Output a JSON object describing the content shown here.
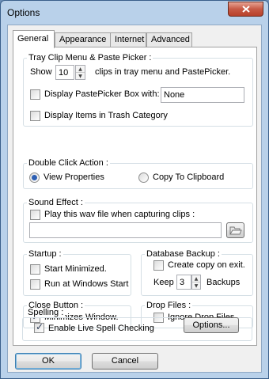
{
  "window": {
    "title": "Options"
  },
  "tabs": [
    "General",
    "Appearance",
    "Internet",
    "Advanced"
  ],
  "tray": {
    "title": "Tray Clip Menu & Paste Picker :",
    "show_label": "Show",
    "clips_count": "10",
    "clips_suffix": "clips in tray menu and PastePicker.",
    "display_box_label": "Display PastePicker Box  with:",
    "display_box_value": "None",
    "trash_label": "Display Items in Trash Category"
  },
  "double_click": {
    "title": "Double Click Action :",
    "option_view": "View Properties",
    "option_copy": "Copy To Clipboard"
  },
  "sound": {
    "title": "Sound Effect :",
    "play_label": "Play this wav file when capturing clips :",
    "path_value": ""
  },
  "startup": {
    "title": "Startup :",
    "minimized_label": "Start Minimized.",
    "windows_label": "Run at Windows Start"
  },
  "database": {
    "title": "Database Backup :",
    "copy_label": "Create copy on exit.",
    "keep_label": "Keep",
    "keep_value": "3",
    "backups_label": "Backups"
  },
  "close_button": {
    "title": "Close Button :",
    "minimizes_label": "Minimizes Window."
  },
  "drop_files": {
    "title": "Drop Files :",
    "ignore_label": "Ignore Drop Files."
  },
  "spelling": {
    "title": "Spelling :",
    "enable_label": "Enable Live Spell Checking",
    "options_button": "Options..."
  },
  "footer": {
    "ok": "OK",
    "cancel": "Cancel"
  }
}
